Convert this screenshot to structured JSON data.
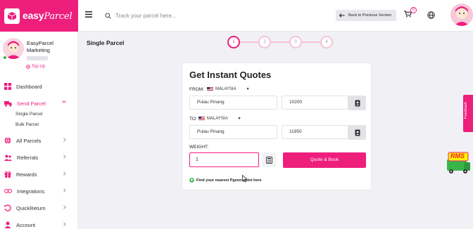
{
  "brand": {
    "name": "easy",
    "name_script": "Parcel"
  },
  "header": {
    "search_placeholder": "Track your parcel here...",
    "prev_version_label": "Back to Previous Version",
    "cart_count": "0"
  },
  "profile": {
    "name": "EasyParcel Marketing",
    "topup_label": "Top Up"
  },
  "sidebar": {
    "items": [
      {
        "label": "Dashboard",
        "icon": "dashboard-icon"
      },
      {
        "label": "Send Parcel",
        "icon": "truck-icon",
        "active": true
      },
      {
        "label": "All Parcels",
        "icon": "globe-icon"
      },
      {
        "label": "Referrals",
        "icon": "referrals-icon"
      },
      {
        "label": "Rewards",
        "icon": "gift-icon"
      },
      {
        "label": "Integrations",
        "icon": "link-icon"
      },
      {
        "label": "QuickReturn",
        "icon": "return-icon"
      },
      {
        "label": "Account",
        "icon": "user-icon"
      }
    ],
    "sub_items": [
      "Single Parcel",
      "Bulk Parcel"
    ]
  },
  "page": {
    "title": "Single Parcel"
  },
  "steps": [
    "1",
    "2",
    "3",
    "4"
  ],
  "quote": {
    "title": "Get Instant Quotes",
    "from_label": "FROM:",
    "to_label": "TO:",
    "from_country": "MALAYSIA",
    "to_country": "MALAYSIA",
    "from_state": "Pulau Pinang",
    "from_postcode": "10200",
    "to_state": "Pulau Pinang",
    "to_postcode": "11950",
    "weight_label": "WEIGHT:",
    "weight_value": "1",
    "button_label": "Quote & Book",
    "pigeon_link": "Find your nearest Pgeon point here"
  },
  "feedback": {
    "label": "Feedback"
  },
  "rms": {
    "label": "RMS"
  },
  "colors": {
    "accent": "#ee1e7d",
    "step_inactive": "#f6c3d6"
  }
}
